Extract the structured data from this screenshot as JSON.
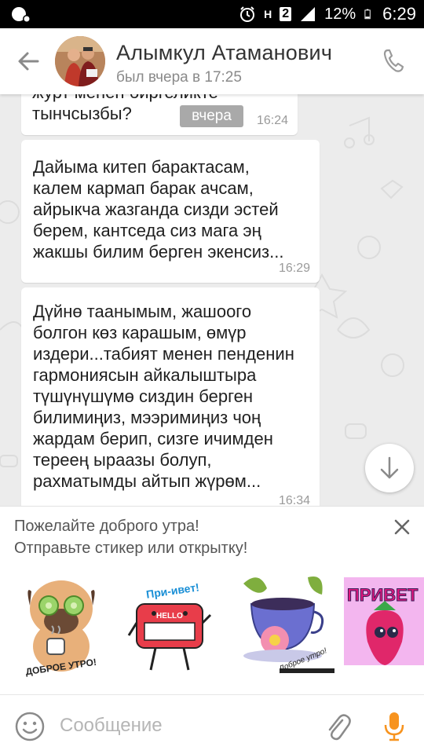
{
  "status_bar": {
    "battery": "12%",
    "time": "6:29",
    "sim_label": "2",
    "network_label": "H",
    "icons": [
      "notification-icon",
      "alarm-icon",
      "network-h-icon",
      "sim-2-icon",
      "signal-icon",
      "battery-icon"
    ]
  },
  "header": {
    "contact_name": "Алымкул Атаманович",
    "last_seen": "был вчера в 17:25",
    "icons": [
      "back-arrow-icon",
      "phone-icon"
    ]
  },
  "chat": {
    "day_separator": "вчера",
    "messages": [
      {
        "lines": [
          "журт менен биргеликте",
          "тынчсызбы?"
        ],
        "time": "16:24"
      },
      {
        "lines": [
          "Дайыма китеп барактасам,",
          "калем кармап барак ачсам,",
          "айрыкча жазганда сизди эстей",
          "берем, кантседа сиз мага эң",
          "жакшы билим берген экенсиз..."
        ],
        "time": "16:29"
      },
      {
        "lines": [
          "Дүйнө таанымым, жашоого",
          "болгон көз карашым, өмүр",
          "издери...табият менен пенденин",
          "гармониясын айкалыштыра",
          "түшүнүшүмө сиздин берген",
          "билимиңиз, мээримиңиз чоң",
          "жардам берип, сизге ичимден",
          "тереең ыраазы болуп,",
          "рахматымды айтып жүрөм..."
        ],
        "time": "16:34"
      }
    ]
  },
  "promo": {
    "line1": "Пожелайте доброго утра!",
    "line2": "Отправьте стикер или открытку!",
    "stickers": [
      {
        "name": "pug-sticker",
        "caption": "ДОБРОЕ УТРО!"
      },
      {
        "name": "hello-badge-sticker",
        "caption": "При-ивет!",
        "badge": "HELLO"
      },
      {
        "name": "tea-cup-sticker",
        "caption": "Доброе утро!"
      },
      {
        "name": "strawberry-sticker",
        "caption": "ПРИВЕТ"
      }
    ]
  },
  "input_bar": {
    "placeholder": "Сообщение",
    "icons": [
      "emoji-icon",
      "paperclip-icon",
      "microphone-icon"
    ]
  },
  "colors": {
    "accent_orange": "#f7931e",
    "header_bg": "#ffffff",
    "chat_bg": "#ececec",
    "day_pill": "#a9a9a9",
    "icon_gray": "#8a8a8a"
  }
}
